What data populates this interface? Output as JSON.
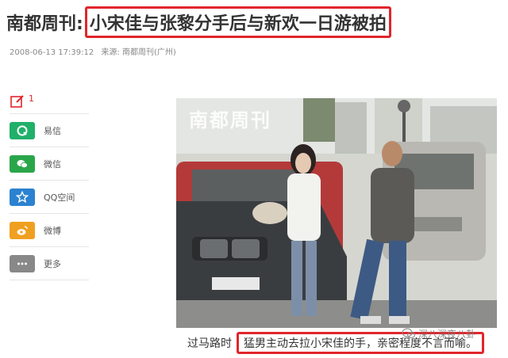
{
  "headline": {
    "source_prefix": "南都周刊:",
    "title": "小宋佳与张黎分手后与新欢一日游被拍"
  },
  "meta": {
    "datetime": "2008-06-13 17:39:12",
    "source": "来源: 南都周刊(广州)"
  },
  "share": {
    "edit_count": "1",
    "items": [
      {
        "label": "易信",
        "icon": "yixin-icon",
        "color": "#20b06a"
      },
      {
        "label": "微信",
        "icon": "wechat-icon",
        "color": "#2aa64a"
      },
      {
        "label": "QQ空间",
        "icon": "qzone-icon",
        "color": "#2b82d0"
      },
      {
        "label": "微博",
        "icon": "weibo-icon",
        "color": "#f0a020"
      },
      {
        "label": "更多",
        "icon": "more-icon",
        "color": "#888888"
      }
    ]
  },
  "photo": {
    "watermark": "南都周刊"
  },
  "caption": {
    "lead": "过马路时",
    "text": "猛男主动去拉小宋佳的手，亲密程度不言而喻。"
  },
  "brand": {
    "text": "深八深夜八卦"
  },
  "colors": {
    "highlight_red": "#e0262b"
  }
}
